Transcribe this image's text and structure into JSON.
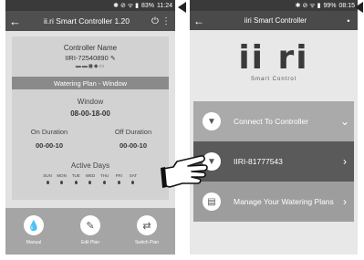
{
  "phone1": {
    "status": {
      "icons": "✱ ⊘ ᯤ ▮",
      "battery": "83%",
      "time": "11:24"
    },
    "appbar": {
      "back": "←",
      "title": "ii.ri Smart Controller 1.20",
      "power": "⏻",
      "more": "⋮"
    },
    "controller": {
      "name_label": "Controller Name",
      "id": "IIRI-72540890",
      "edit_icon": "✎",
      "status_icons": "▬▬◼◆▭"
    },
    "plan_title": "Watering Plan - Window",
    "window": {
      "label": "Window",
      "value": "08-00-18-00"
    },
    "on_duration": {
      "label": "On Duration",
      "value": "00-00-10"
    },
    "off_duration": {
      "label": "Off Duration",
      "value": "00-00-10"
    },
    "active_days": {
      "label": "Active Days",
      "days": [
        "SUN",
        "MON",
        "TUE",
        "WED",
        "THU",
        "FRI",
        "SAT"
      ]
    },
    "buttons": [
      {
        "label": "Manual",
        "icon": "💧"
      },
      {
        "label": "Edit Plan",
        "icon": "✎"
      },
      {
        "label": "Switch Plan",
        "icon": "⇄"
      }
    ]
  },
  "phone2": {
    "status": {
      "icons": "✱ ⊘ ᯤ ▮",
      "battery": "99%",
      "time": "08:15"
    },
    "appbar": {
      "back": "←",
      "title": "iiri Smart Controller",
      "dot": "•"
    },
    "logo": {
      "text": "ii ri",
      "tagline": "Smart Control"
    },
    "rows": [
      {
        "label": "Connect To Controller",
        "chevron": "⌄",
        "icon": "▼"
      },
      {
        "label": "IIRI-81777543",
        "chevron": "›",
        "icon": "▼"
      },
      {
        "label": "Manage Your Watering Plans",
        "chevron": "›",
        "icon": "▤"
      }
    ]
  },
  "colors": {
    "appbar": "#4f4f4f",
    "card": "#d2d2d2",
    "plan_bar": "#8a8a8a",
    "bottom_bar": "#a5a5a5",
    "selected_row": "#5a5a5a"
  }
}
